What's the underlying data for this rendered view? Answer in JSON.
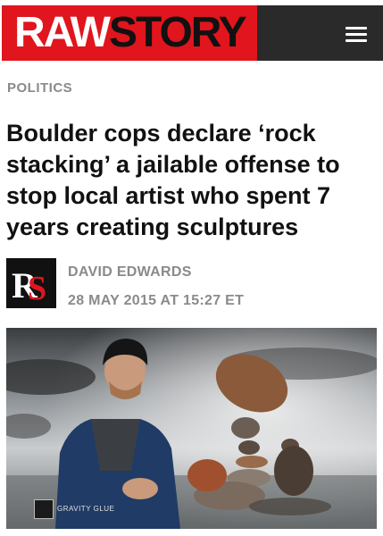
{
  "header": {
    "logo_part1": "RAW",
    "logo_part2": "STORY",
    "menu_icon": "hamburger-menu-icon"
  },
  "article": {
    "category": "POLITICS",
    "headline": "Boulder cops declare ‘rock stacking’ a jailable offense to stop local artist who spent 7 years creating sculptures",
    "avatar_text": "RS",
    "author": "DAVID EDWARDS",
    "date": "28 MAY 2015 AT 15:27 ET",
    "photo_watermark": "GRAVITY GLUE"
  },
  "colors": {
    "brand_red": "#e1151d",
    "menu_bg": "#2a2a2a",
    "meta_gray": "#8a8a8a"
  }
}
